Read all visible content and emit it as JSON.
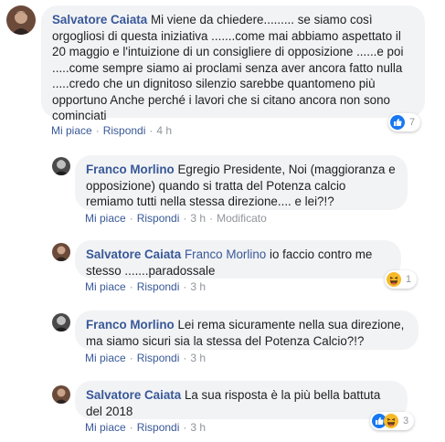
{
  "comments": [
    {
      "author": "Salvatore Caiata",
      "text": "Mi viene da chiedere......... se siamo così orgogliosi di questa iniziativa .......come mai abbiamo aspettato il 20 maggio e l'intuizione di un consigliere di opposizione ......e poi .....come sempre siamo ai proclami senza aver ancora fatto nulla .....credo che un dignitoso silenzio sarebbe quantomeno più opportuno Anche perché i lavori che si citano ancora non sono cominciati",
      "like": "Mi piace",
      "reply": "Rispondi",
      "time": "4 h",
      "reaction_count": "7",
      "reaction_icons": [
        "like-icon"
      ]
    },
    {
      "author": "Franco Morlino",
      "text": "Egregio Presidente, Noi (maggioranza e opposizione) quando si tratta del Potenza calcio remiamo tutti nella stessa direzione.... e lei?!?",
      "like": "Mi piace",
      "reply": "Rispondi",
      "time": "3 h",
      "edited": "Modificato"
    },
    {
      "author": "Salvatore Caiata",
      "mention": "Franco Morlino",
      "text": "io faccio contro me stesso .......paradossale",
      "like": "Mi piace",
      "reply": "Rispondi",
      "time": "3 h",
      "reaction_count": "1",
      "reaction_icons": [
        "haha-icon"
      ]
    },
    {
      "author": "Franco Morlino",
      "text": "Lei rema sicuramente nella sua direzione, ma siamo sicuri sia la stessa del Potenza Calcio?!?",
      "like": "Mi piace",
      "reply": "Rispondi",
      "time": "3 h"
    },
    {
      "author": "Salvatore Caiata",
      "text": "La sua risposta è la più bella battuta del 2018",
      "like": "Mi piace",
      "reply": "Rispondi",
      "time": "3 h",
      "reaction_count": "3",
      "reaction_icons": [
        "like-icon",
        "haha-icon"
      ]
    }
  ],
  "colors": {
    "link": "#385898",
    "bubble": "#f2f3f5",
    "meta": "#90949c",
    "like_blue": "#1877f2",
    "haha_yellow": "#f7b928"
  }
}
